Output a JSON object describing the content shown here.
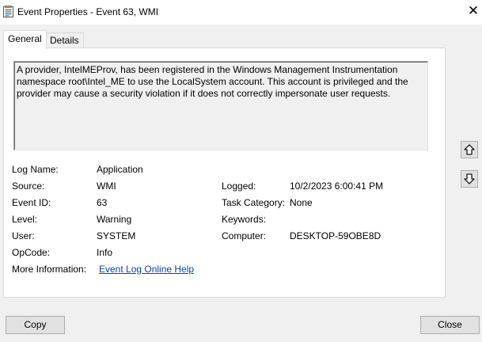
{
  "window": {
    "title": "Event Properties - Event 63, WMI",
    "close_glyph": "✕"
  },
  "tabs": [
    {
      "label": "General",
      "active": true
    },
    {
      "label": "Details",
      "active": false
    }
  ],
  "description": "A provider, IntelMEProv, has been registered in the Windows Management Instrumentation namespace root\\Intel_ME to use the LocalSystem account. This account is privileged and the provider may cause a security violation if it does not correctly impersonate user requests.",
  "fields": {
    "log_name": {
      "label": "Log Name:",
      "value": "Application"
    },
    "source": {
      "label": "Source:",
      "value": "WMI"
    },
    "event_id": {
      "label": "Event ID:",
      "value": "63"
    },
    "level": {
      "label": "Level:",
      "value": "Warning"
    },
    "user": {
      "label": "User:",
      "value": "SYSTEM"
    },
    "opcode": {
      "label": "OpCode:",
      "value": "Info"
    },
    "more_info": {
      "label": "More Information:",
      "value": "Event Log Online Help"
    },
    "logged": {
      "label": "Logged:",
      "value": "10/2/2023 6:00:41 PM"
    },
    "task_category": {
      "label": "Task Category:",
      "value": "None"
    },
    "keywords": {
      "label": "Keywords:",
      "value": ""
    },
    "computer": {
      "label": "Computer:",
      "value": "DESKTOP-59OBE8D"
    }
  },
  "buttons": {
    "copy": "Copy",
    "close": "Close"
  },
  "icons": {
    "app": "event-viewer-icon",
    "up": "arrow-up-icon",
    "down": "arrow-down-icon"
  },
  "colors": {
    "link": "#0645ad",
    "window_bg": "#f0f0f0",
    "panel_bg": "#ffffff"
  }
}
